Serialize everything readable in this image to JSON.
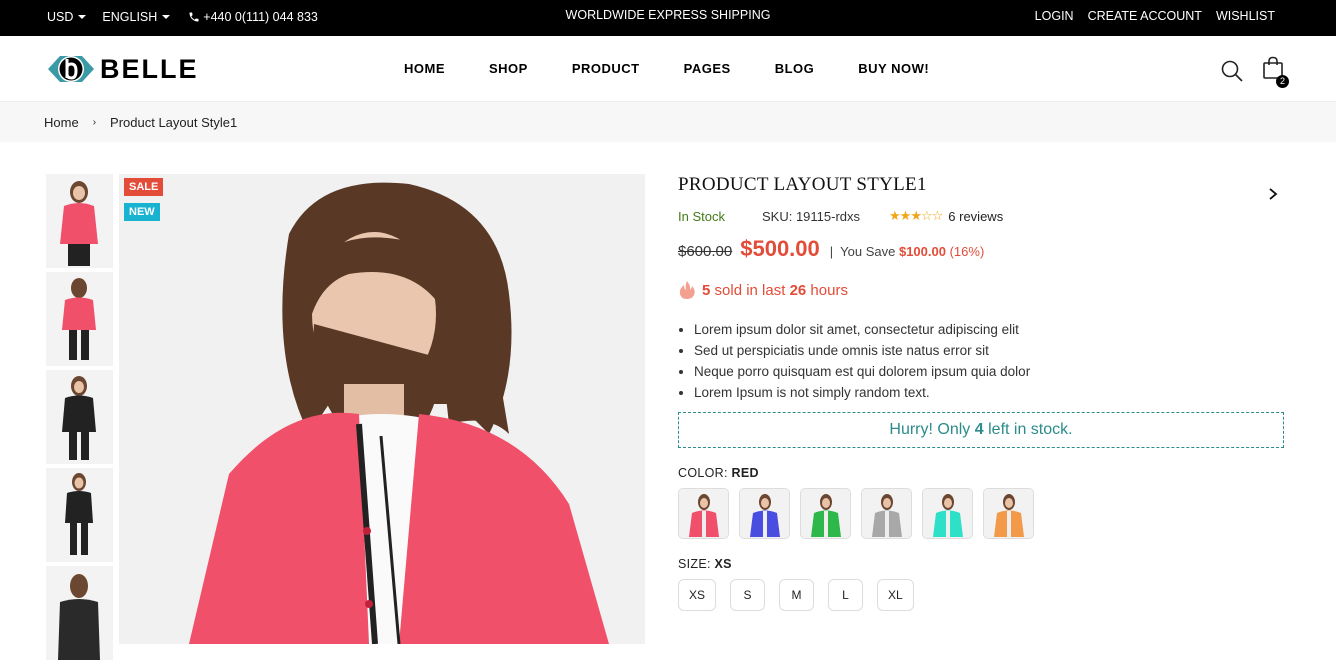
{
  "topbar": {
    "currency": "USD",
    "language": "ENGLISH",
    "phone": "+440 0(111) 044 833",
    "shipping": "WORLDWIDE EXPRESS SHIPPING",
    "login": "LOGIN",
    "create_account": "CREATE ACCOUNT",
    "wishlist": "WISHLIST"
  },
  "header": {
    "logo_text": "BELLE",
    "nav": [
      "HOME",
      "SHOP",
      "PRODUCT",
      "PAGES",
      "BLOG",
      "BUY NOW!"
    ],
    "cart_count": "2"
  },
  "breadcrumb": {
    "home": "Home",
    "current": "Product Layout Style1"
  },
  "gallery": {
    "sale_tag": "SALE",
    "new_tag": "NEW",
    "thumb_count": 5
  },
  "product": {
    "title": "PRODUCT LAYOUT STYLE1",
    "stock": "In Stock",
    "sku": "SKU: 19115-rdxs",
    "rating": 3,
    "rating_max": 5,
    "reviews": "6 reviews",
    "old_price": "$600.00",
    "new_price": "$500.00",
    "separator": "|",
    "you_save_label": "You Save",
    "save_amount": "$100.00",
    "save_percent": "(16%)",
    "sold_count": "5",
    "sold_mid": "sold in last",
    "sold_hours": "26",
    "sold_suffix": "hours",
    "bullets": [
      "Lorem ipsum dolor sit amet, consectetur adipiscing elit",
      "Sed ut perspiciatis unde omnis iste natus error sit",
      "Neque porro quisquam est qui dolorem ipsum quia dolor",
      "Lorem Ipsum is not simply random text."
    ],
    "hurry_prefix": "Hurry! Only",
    "hurry_count": "4",
    "hurry_suffix": "left in stock.",
    "color_label": "COLOR:",
    "color_value": "RED",
    "colors": [
      "#f0506a",
      "#4a4ee0",
      "#2fb84a",
      "#a8a8a8",
      "#2ee0c8",
      "#f29a4a"
    ],
    "size_label": "SIZE:",
    "size_value": "XS",
    "sizes": [
      "XS",
      "S",
      "M",
      "L",
      "XL"
    ]
  },
  "colors": {
    "accent_red": "#e24c38",
    "teal": "#2b8c8c",
    "stock_green": "#447a18",
    "star": "#f0a51a"
  }
}
